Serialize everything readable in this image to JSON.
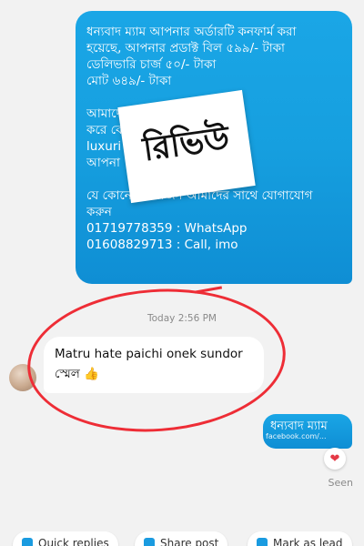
{
  "outgoing_message": {
    "lines": [
      "ধন্যবাদ ম্যাম আপনার অর্ডারটি কনফার্ম করা",
      "হয়েছে, আপনার প্রডাক্ট বিল ৫৯৯/- টাকা",
      "ডেলিভারি চার্জ ৫০/- টাকা",
      "মোট ৬৪৯/- টাকা",
      "",
      "আমাদের এক                     নাকে ফোন",
      "করে                                     বেন।",
      "luxuri                                    জন্য",
      "আপনা",
      "",
      "যে কোনো প্রয়োজন আমাদের সাথে যোগাযোগ",
      "করুন",
      "01719778359  : WhatsApp",
      "01608829713  : Call, imo"
    ]
  },
  "sticker": {
    "text": "রিভিউ"
  },
  "timestamp": "Today 2:56 PM",
  "incoming_message": {
    "line1": "Matru hate paichi onek sundor",
    "line2": "স্মেল 👍"
  },
  "reply_message": {
    "text": "ধন্যবাদ ম্যাম",
    "watermark": "facebook.com/..."
  },
  "reaction": "❤",
  "seen_label": "Seen",
  "quick_actions": [
    {
      "label": "Quick replies",
      "icon": "quick-reply-icon"
    },
    {
      "label": "Share post",
      "icon": "share-icon"
    },
    {
      "label": "Mark as lead",
      "icon": "lead-icon"
    }
  ],
  "colors": {
    "outgoing_bubble": "#169fdf",
    "incoming_bubble": "#ffffff",
    "highlight_circle": "#ee2d36",
    "background": "#f2f2f2"
  }
}
